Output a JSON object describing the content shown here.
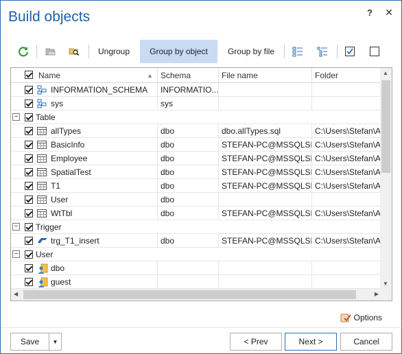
{
  "window": {
    "title": "Build objects",
    "help_label": "?",
    "close_label": "✕"
  },
  "toolbar": {
    "ungroup_label": "Ungroup",
    "group_by_object_label": "Group by object",
    "group_by_file_label": "Group by file"
  },
  "grid": {
    "columns": [
      "Name",
      "Schema",
      "File name",
      "Folder"
    ],
    "rows": [
      {
        "kind": "item",
        "name": "INFORMATION_SCHEMA",
        "schema": "INFORMATIO...",
        "file": "",
        "folder": "",
        "icon": "schema-icon"
      },
      {
        "kind": "item",
        "name": "sys",
        "schema": "sys",
        "file": "",
        "folder": "",
        "icon": "schema-icon"
      },
      {
        "kind": "group",
        "name": "Table"
      },
      {
        "kind": "item",
        "name": "allTypes",
        "schema": "dbo",
        "file": "dbo.allTypes.sql",
        "folder": "C:\\Users\\Stefan\\App",
        "icon": "table-icon"
      },
      {
        "kind": "item",
        "name": "BasicInfo",
        "schema": "dbo",
        "file": "STEFAN-PC@MSSQLSE...",
        "folder": "C:\\Users\\Stefan\\App",
        "icon": "table-icon"
      },
      {
        "kind": "item",
        "name": "Employee",
        "schema": "dbo",
        "file": "STEFAN-PC@MSSQLSE...",
        "folder": "C:\\Users\\Stefan\\App",
        "icon": "table-icon"
      },
      {
        "kind": "item",
        "name": "SpatialTest",
        "schema": "dbo",
        "file": "STEFAN-PC@MSSQLSE...",
        "folder": "C:\\Users\\Stefan\\App",
        "icon": "table-icon"
      },
      {
        "kind": "item",
        "name": "T1",
        "schema": "dbo",
        "file": "STEFAN-PC@MSSQLSE...",
        "folder": "C:\\Users\\Stefan\\App",
        "icon": "table-icon"
      },
      {
        "kind": "item",
        "name": "User",
        "schema": "dbo",
        "file": "",
        "folder": "",
        "icon": "table-icon"
      },
      {
        "kind": "item",
        "name": "WtTbl",
        "schema": "dbo",
        "file": "STEFAN-PC@MSSQLSE...",
        "folder": "C:\\Users\\Stefan\\App",
        "icon": "table-icon"
      },
      {
        "kind": "group",
        "name": "Trigger"
      },
      {
        "kind": "item",
        "name": "trg_T1_insert",
        "schema": "dbo",
        "file": "STEFAN-PC@MSSQLSE...",
        "folder": "C:\\Users\\Stefan\\App",
        "icon": "trigger-icon"
      },
      {
        "kind": "group",
        "name": "User"
      },
      {
        "kind": "item",
        "name": "dbo",
        "schema": "",
        "file": "",
        "folder": "",
        "icon": "user-icon"
      },
      {
        "kind": "item",
        "name": "guest",
        "schema": "",
        "file": "",
        "folder": "",
        "icon": "user-icon"
      }
    ]
  },
  "options_label": "Options",
  "footer": {
    "save_label": "Save",
    "prev_label": "< Prev",
    "next_label": "Next >",
    "cancel_label": "Cancel"
  },
  "colors": {
    "accent": "#1f5fa8",
    "active_tool": "#c9daf3"
  }
}
